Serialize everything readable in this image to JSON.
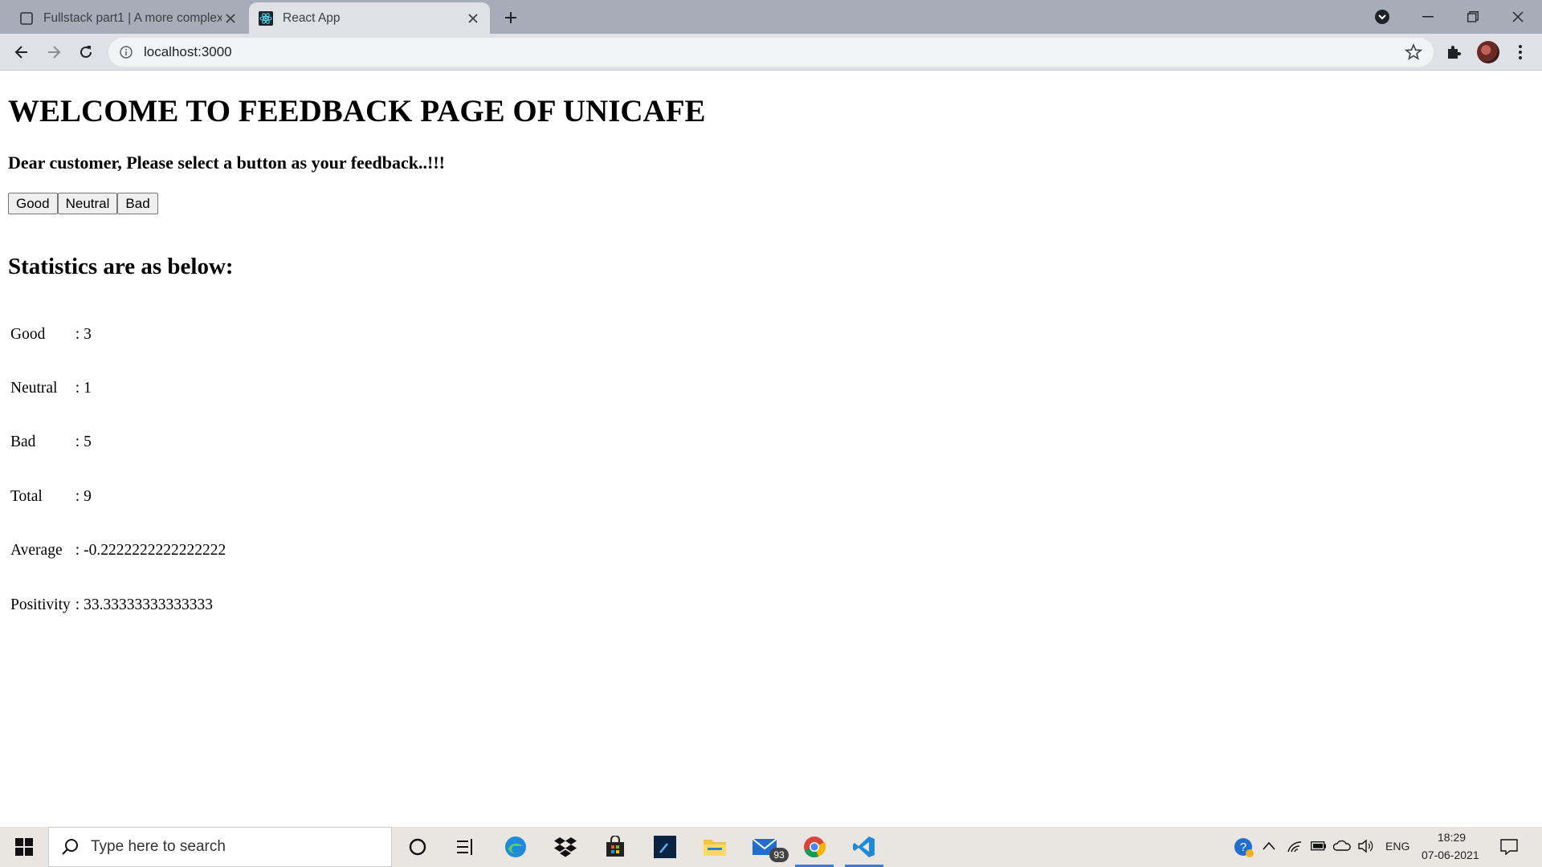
{
  "browser": {
    "tabs": [
      {
        "title": "Fullstack part1 | A more complex",
        "active": false
      },
      {
        "title": "React App",
        "active": true
      }
    ],
    "url": "localhost:3000"
  },
  "page": {
    "heading": "WELCOME TO FEEDBACK PAGE OF UNICAFE",
    "subheading": "Dear customer, Please select a button as your feedback..!!!",
    "buttons": {
      "good": "Good",
      "neutral": "Neutral",
      "bad": "Bad"
    },
    "stats_heading": "Statistics are as below:",
    "stats": [
      {
        "label": "Good",
        "value": ": 3"
      },
      {
        "label": "Neutral",
        "value": ": 1"
      },
      {
        "label": "Bad",
        "value": ": 5"
      },
      {
        "label": "Total",
        "value": ": 9"
      },
      {
        "label": "Average",
        "value": ": -0.2222222222222222"
      },
      {
        "label": "Positivity",
        "value": ": 33.33333333333333"
      }
    ]
  },
  "taskbar": {
    "search_placeholder": "Type here to search",
    "mail_badge": "93",
    "language": "ENG",
    "time": "18:29",
    "date": "07-06-2021"
  },
  "colors": {
    "tabbar": "#a7adb8",
    "toolbar": "#dee1e6",
    "taskbar": "#e9e6e2",
    "active_indicator": "#3a7bd5"
  }
}
